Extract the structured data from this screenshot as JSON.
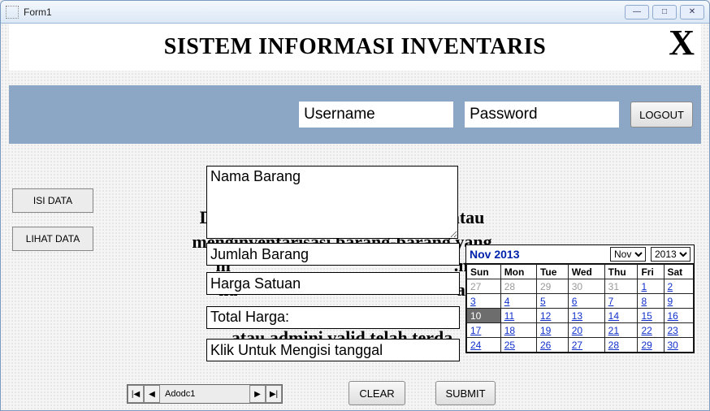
{
  "window": {
    "title": "Form1"
  },
  "header": {
    "title": "SISTEM INFORMASI INVENTARIS",
    "close_x": "X"
  },
  "login": {
    "username_placeholder": "Username",
    "password_placeholder": "Password",
    "logout_label": "LOGOUT"
  },
  "sidebar": {
    "isi_data": "ISI DATA",
    "lihat_data": "LIHAT DATA"
  },
  "bg_text": "Di ... atau\nmenginventarisasi barang-barang yang\nm ... n\nha ... a\nyang ... \natau admini valid telah terda",
  "fields": {
    "nama_barang": "Nama Barang",
    "jumlah_barang": "Jumlah Barang",
    "harga_satuan": "Harga Satuan",
    "total_harga_label": "Total Harga:",
    "tanggal_hint": "Klik Untuk Mengisi tanggal"
  },
  "calendar": {
    "title": "Nov 2013",
    "month_selected": "Nov",
    "year_selected": "2013",
    "days": [
      "Sun",
      "Mon",
      "Tue",
      "Wed",
      "Thu",
      "Fri",
      "Sat"
    ],
    "rows": [
      [
        {
          "n": "27",
          "dim": true
        },
        {
          "n": "28",
          "dim": true
        },
        {
          "n": "29",
          "dim": true
        },
        {
          "n": "30",
          "dim": true
        },
        {
          "n": "31",
          "dim": true
        },
        {
          "n": "1"
        },
        {
          "n": "2"
        }
      ],
      [
        {
          "n": "3"
        },
        {
          "n": "4"
        },
        {
          "n": "5"
        },
        {
          "n": "6"
        },
        {
          "n": "7"
        },
        {
          "n": "8"
        },
        {
          "n": "9"
        }
      ],
      [
        {
          "n": "10",
          "today": true
        },
        {
          "n": "11"
        },
        {
          "n": "12"
        },
        {
          "n": "13"
        },
        {
          "n": "14"
        },
        {
          "n": "15"
        },
        {
          "n": "16"
        }
      ],
      [
        {
          "n": "17"
        },
        {
          "n": "18"
        },
        {
          "n": "19"
        },
        {
          "n": "20"
        },
        {
          "n": "21"
        },
        {
          "n": "22"
        },
        {
          "n": "23"
        }
      ],
      [
        {
          "n": "24"
        },
        {
          "n": "25"
        },
        {
          "n": "26"
        },
        {
          "n": "27"
        },
        {
          "n": "28"
        },
        {
          "n": "29"
        },
        {
          "n": "30"
        }
      ]
    ]
  },
  "navigator": {
    "label": "Adodc1"
  },
  "buttons": {
    "clear": "CLEAR",
    "submit": "SUBMIT"
  },
  "icons": {
    "first": "|◀",
    "prev": "◀",
    "next": "▶",
    "last": "▶|",
    "min": "—",
    "max": "□",
    "close": "✕"
  }
}
